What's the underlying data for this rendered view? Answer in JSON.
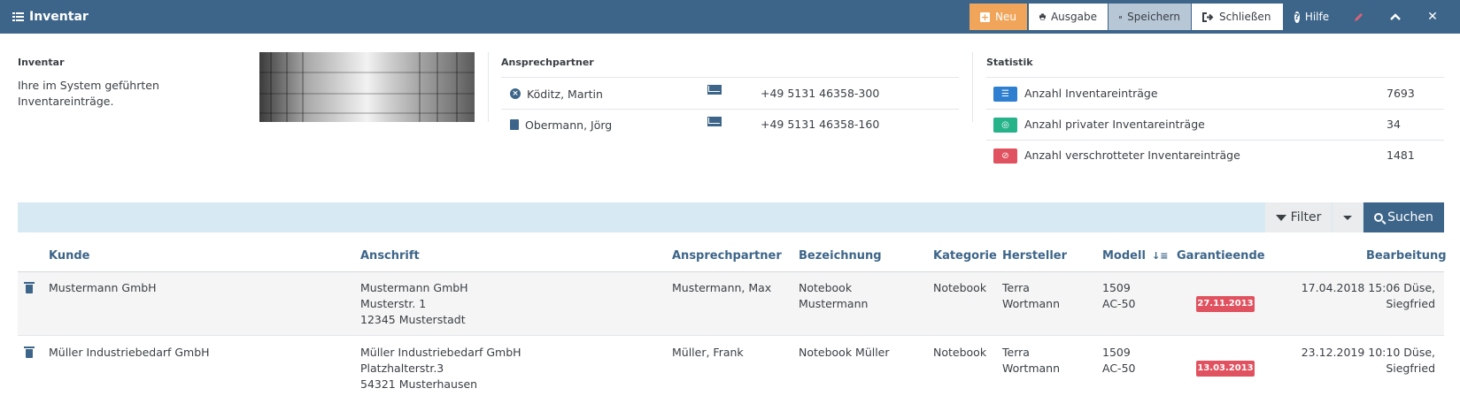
{
  "app": {
    "title": "Inventar"
  },
  "toolbar": {
    "neu": "Neu",
    "ausgabe": "Ausgabe",
    "speichern": "Speichern",
    "schliessen": "Schließen",
    "hilfe": "Hilfe",
    "close_glyph": "✕",
    "collapse_glyph": "︿"
  },
  "info": {
    "heading": "Inventar",
    "description": "Ihre im System geführten Inventareinträge."
  },
  "contacts": {
    "heading": "Ansprechpartner",
    "items": [
      {
        "name": "Köditz, Martin",
        "phone": "+49 5131 46358-300",
        "icon": "x-circle-icon"
      },
      {
        "name": "Obermann, Jörg",
        "phone": "+49 5131 46358-160",
        "icon": "book-icon"
      }
    ]
  },
  "stats": {
    "heading": "Statistik",
    "items": [
      {
        "label": "Anzahl Inventareinträge",
        "value": "7693",
        "color": "#2f7fd0",
        "icon": "list-icon"
      },
      {
        "label": "Anzahl privater Inventareinträge",
        "value": "34",
        "color": "#27b38a",
        "icon": "eye-slash-icon"
      },
      {
        "label": "Anzahl verschrotteter Inventareinträge",
        "value": "1481",
        "color": "#e0525f",
        "icon": "ban-icon"
      }
    ]
  },
  "search": {
    "filter": "Filter",
    "suchen": "Suchen"
  },
  "table": {
    "headers": {
      "kunde": "Kunde",
      "anschrift": "Anschrift",
      "ansprechpartner": "Ansprechpartner",
      "bezeichnung": "Bezeichnung",
      "kategorie": "Kategorie",
      "hersteller": "Hersteller",
      "modell": "Modell",
      "garantieende": "Garantieende",
      "bearbeitung": "Bearbeitung"
    },
    "rows": [
      {
        "kunde": "Mustermann GmbH",
        "anschrift": [
          "Mustermann GmbH",
          "Musterstr. 1",
          "12345 Musterstadt"
        ],
        "ansprechpartner": "Mustermann, Max",
        "bezeichnung": [
          "Notebook",
          "Mustermann"
        ],
        "kategorie": "Notebook",
        "hersteller": [
          "Terra",
          "Wortmann"
        ],
        "modell": [
          "1509",
          "AC-50"
        ],
        "garantieende": "27.11.2013",
        "bearbeitung": [
          "17.04.2018 15:06 Düse,",
          "Siegfried"
        ]
      },
      {
        "kunde": "Müller Industriebedarf GmbH",
        "anschrift": [
          "Müller Industriebedarf GmbH",
          "Platzhalterstr.3",
          "54321 Musterhausen"
        ],
        "ansprechpartner": "Müller, Frank",
        "bezeichnung": [
          "Notebook Müller"
        ],
        "kategorie": "Notebook",
        "hersteller": [
          "Terra",
          "Wortmann"
        ],
        "modell": [
          "1509",
          "AC-50"
        ],
        "garantieende": "13.03.2013",
        "bearbeitung": [
          "23.12.2019 10:10 Düse,",
          "Siegfried"
        ]
      }
    ]
  },
  "colors": {
    "header_bg": "#3d6589",
    "accent_orange": "#f0a55b",
    "badge_red": "#e0525f",
    "filter_bar": "#d7e9f3"
  }
}
